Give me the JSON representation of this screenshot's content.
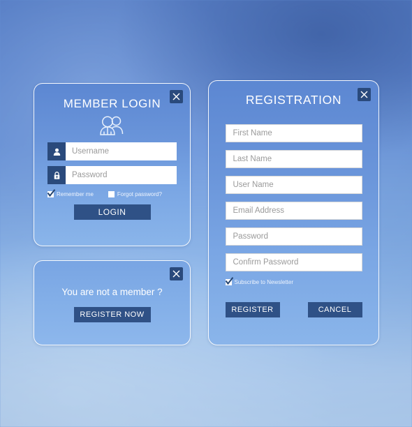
{
  "theme": {
    "accent_dark": "#2a4a7c",
    "button_fill": "#2f5186",
    "panel_border": "#ffffff",
    "field_bg": "#ffffff",
    "placeholder_color": "#9a9a9a",
    "title_color": "#ffffff"
  },
  "login_panel": {
    "title": "MEMBER LOGIN",
    "close_label": "×",
    "members_icon": "members-group-icon",
    "username": {
      "placeholder": "Username",
      "value": "",
      "icon": "user-icon"
    },
    "password": {
      "placeholder": "Password",
      "value": "",
      "icon": "lock-icon"
    },
    "remember_me": {
      "label": "Remember me",
      "checked": true
    },
    "forgot_password": {
      "label": "Forgot password?",
      "checked": false
    },
    "submit_label": "LOGIN"
  },
  "not_member_panel": {
    "message": "You are not a member ?",
    "close_label": "×",
    "register_label": "REGISTER NOW"
  },
  "registration_panel": {
    "title": "REGISTRATION",
    "close_label": "×",
    "fields": [
      {
        "name": "first-name",
        "placeholder": "First Name",
        "value": ""
      },
      {
        "name": "last-name",
        "placeholder": "Last Name",
        "value": ""
      },
      {
        "name": "user-name",
        "placeholder": "User Name",
        "value": ""
      },
      {
        "name": "email-address",
        "placeholder": "Email Address",
        "value": ""
      },
      {
        "name": "password",
        "placeholder": "Password",
        "value": ""
      },
      {
        "name": "confirm-password",
        "placeholder": "Confirm Password",
        "value": ""
      }
    ],
    "newsletter": {
      "label": "Subscribe to Newsletter",
      "checked": true
    },
    "submit_label": "REGISTER",
    "cancel_label": "CANCEL"
  }
}
